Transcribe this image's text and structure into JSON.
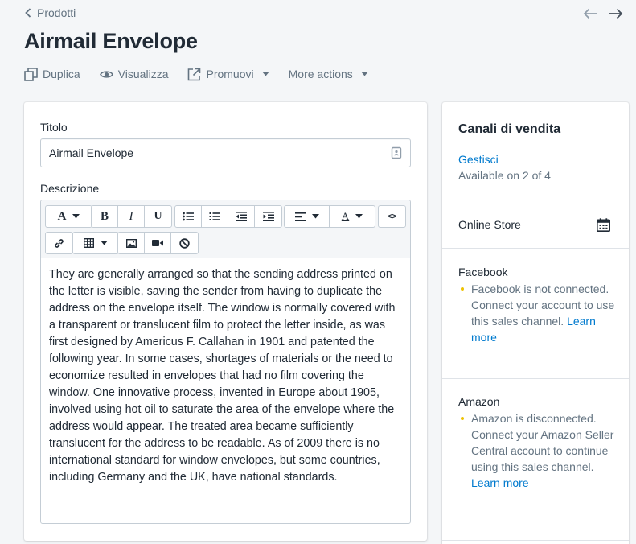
{
  "nav": {
    "back_label": "Prodotti"
  },
  "page": {
    "title": "Airmail Envelope"
  },
  "actions": {
    "duplicate": "Duplica",
    "view": "Visualizza",
    "promote": "Promuovi",
    "more": "More actions"
  },
  "product": {
    "title_label": "Titolo",
    "title_value": "Airmail Envelope",
    "description_label": "Descrizione",
    "description_text": "They are generally arranged so that the sending address printed on the letter is visible, saving the sender from having to duplicate the address on the envelope itself. The window is normally covered with a transparent or translucent film to protect the letter inside, as was first designed by Americus F. Callahan in 1901 and patented the following year. In some cases, shortages of materials or the need to economize resulted in envelopes that had no film covering the window. One innovative process, invented in Europe about 1905, involved using hot oil to saturate the area of the envelope where the address would appear. The treated area became sufficiently translucent for the address to be readable. As of 2009 there is no international standard for window envelopes, but some countries, including Germany and the UK, have national standards."
  },
  "toolbar": {
    "bold": "B",
    "italic": "I",
    "underline": "U",
    "font_glyph": "A",
    "color_glyph": "A",
    "code_glyph": "<>"
  },
  "sales": {
    "title": "Canali di vendita",
    "manage": "Gestisci",
    "available": "Available on 2 of 4",
    "channels": [
      {
        "name": "Online Store"
      },
      {
        "name": "Facebook",
        "note": "Facebook is not connected. Connect your account to use this sales channel.",
        "learn": "Learn more"
      },
      {
        "name": "Amazon",
        "note": "Amazon is disconnected. Connect your Amazon Seller Central account to continue using this sales channel.",
        "learn": "Learn more"
      }
    ]
  },
  "colors": {
    "accent": "#007ace",
    "warning_dot": "#eec200",
    "muted": "#637381"
  }
}
